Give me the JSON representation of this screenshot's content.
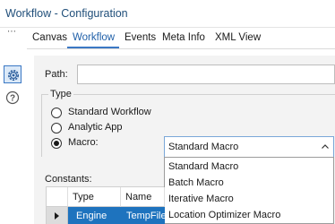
{
  "window": {
    "title": "Workflow - Configuration"
  },
  "sidebar": {
    "more_icon": "more-dots-icon",
    "settings_icon": "gear-icon",
    "help_icon": "help-circle-icon"
  },
  "tabs": [
    {
      "label": "Canvas",
      "active": false
    },
    {
      "label": "Workflow",
      "active": true
    },
    {
      "label": "Events",
      "active": false
    },
    {
      "label": "Meta Info",
      "active": false
    },
    {
      "label": "XML View",
      "active": false
    }
  ],
  "form": {
    "path_label": "Path:",
    "path_value": "",
    "type_group_label": "Type",
    "type_options": [
      {
        "label": "Standard Workflow",
        "selected": false
      },
      {
        "label": "Analytic App",
        "selected": false
      },
      {
        "label": "Macro:",
        "selected": true
      }
    ],
    "macro_select": {
      "value": "Standard Macro",
      "expanded": true,
      "options": [
        "Standard Macro",
        "Batch Macro",
        "Iterative Macro",
        "Location Optimizer Macro"
      ]
    },
    "constants_label": "Constants:"
  },
  "constants_table": {
    "columns": [
      "Type",
      "Name"
    ],
    "rows": [
      {
        "type": "Engine",
        "name": "TempFile",
        "selected": true
      }
    ]
  },
  "colors": {
    "accent": "#3b78c4",
    "selection": "#1e73be",
    "title_text": "#1f4e79",
    "panel_bg": "#f3f3f3"
  }
}
